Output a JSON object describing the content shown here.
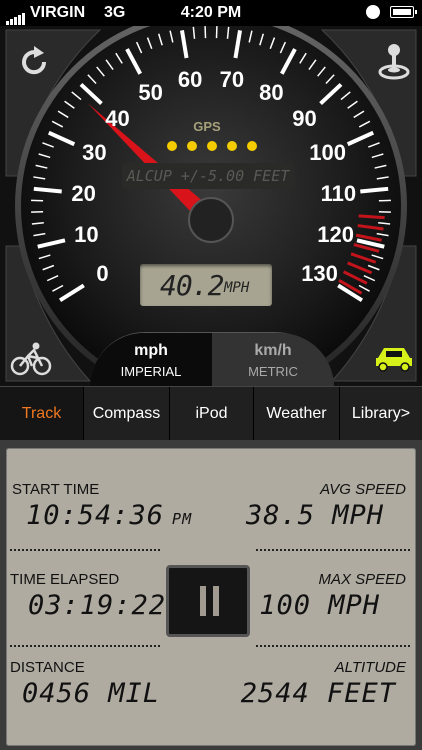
{
  "status_bar": {
    "carrier": "VIRGIN",
    "network": "3G",
    "time": "4:20 PM"
  },
  "speedometer": {
    "tick_labels": [
      "0",
      "10",
      "20",
      "30",
      "40",
      "50",
      "60",
      "70",
      "80",
      "90",
      "100",
      "110",
      "120",
      "130"
    ],
    "gps_label": "GPS",
    "gps_dots": 5,
    "accuracy_text": "ALCUP +/-5.00 FEET",
    "speed_value": "40.2",
    "speed_unit": "MPH",
    "needle_speed": 40.2,
    "max_scale": 130,
    "redline_start": 115,
    "colors": {
      "needle": "#d8131a",
      "redline": "#c4141b",
      "gps_dot": "#f4cc00",
      "car": "#d6f01a"
    }
  },
  "unit_toggle": {
    "mph_label": "mph",
    "imperial_label": "IMPERIAL",
    "kmh_label": "km/h",
    "metric_label": "METRIC",
    "selected": "mph"
  },
  "corner_buttons": {
    "reset_icon": "refresh-icon",
    "gps_icon": "joystick-icon",
    "bike_icon": "bicycle-icon",
    "car_icon": "car-icon"
  },
  "tabs": [
    {
      "label": "Track",
      "active": true
    },
    {
      "label": "Compass",
      "active": false
    },
    {
      "label": "iPod",
      "active": false
    },
    {
      "label": "Weather",
      "active": false
    },
    {
      "label": "Library>",
      "active": false
    }
  ],
  "track": {
    "start_time_label": "START TIME",
    "start_time_value": "10:54:36",
    "start_time_suffix": "PM",
    "avg_speed_label": "AVG SPEED",
    "avg_speed_value": "38.5 MPH",
    "time_elapsed_label": "TIME ELAPSED",
    "time_elapsed_value": "03:19:22",
    "max_speed_label": "MAX SPEED",
    "max_speed_value": "100 MPH",
    "distance_label": "DISTANCE",
    "distance_value": "0456 MIL",
    "altitude_label": "ALTITUDE",
    "altitude_value": "2544 FEET"
  }
}
